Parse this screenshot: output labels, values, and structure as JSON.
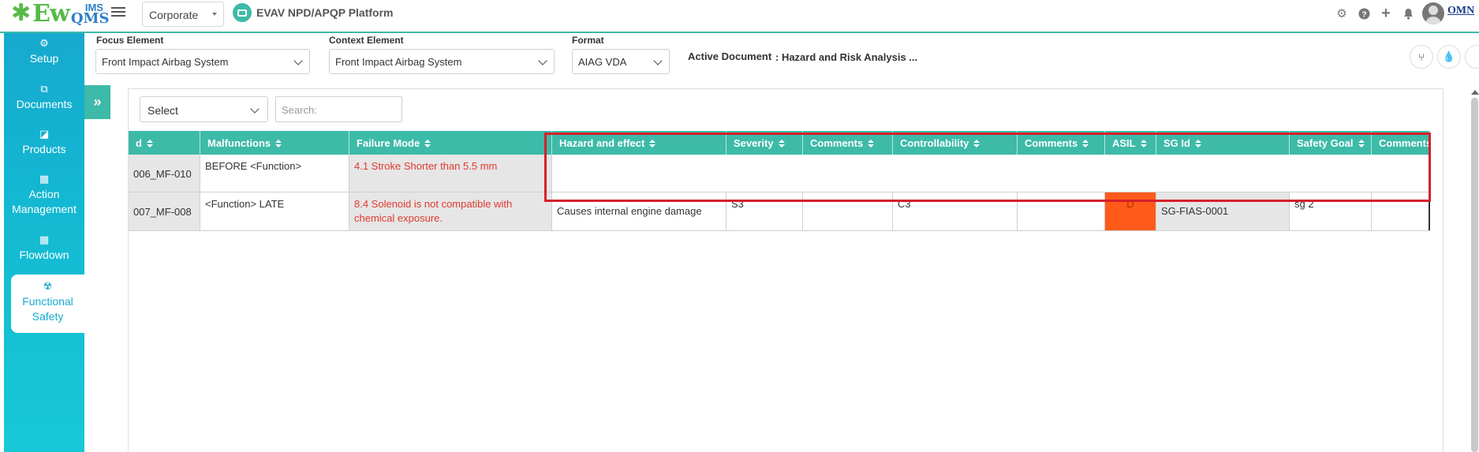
{
  "app": {
    "logo_main": "Ew",
    "logo_top": "IMS",
    "logo_bottom": "QMS",
    "org_select": "Corporate",
    "platform_name": "EVAV NPD/APQP Platform",
    "brand_partial": "OMN"
  },
  "top_icons": [
    "gear-icon",
    "help-icon",
    "plus-icon",
    "bell-icon",
    "user-avatar"
  ],
  "sidebar": {
    "items": [
      {
        "label": "Setup",
        "icon": "cogs-icon"
      },
      {
        "label": "Documents",
        "icon": "copy-icon"
      },
      {
        "label": "Products",
        "icon": "tag-icon"
      },
      {
        "label": "Action Management",
        "icon": "building-icon"
      },
      {
        "label": "Flowdown",
        "icon": "building-icon"
      },
      {
        "label": "Functional Safety",
        "icon": "safety-icon",
        "active": true
      }
    ]
  },
  "filters": {
    "focus_label": "Focus Element",
    "focus_value": "Front Impact Airbag System",
    "context_label": "Context Element",
    "context_value": "Front Impact Airbag System",
    "format_label": "Format",
    "format_value": "AIAG VDA",
    "active_doc_label": "Active Document",
    "active_doc_value": ": Hazard and Risk Analysis ..."
  },
  "toolbar": {
    "column_select": "Select",
    "search_placeholder": "Search:"
  },
  "table": {
    "headers": [
      "d",
      "Malfunctions",
      "Failure Mode",
      "Hazard and effect",
      "Severity",
      "Comments",
      "Controllability",
      "Comments",
      "ASIL",
      "SG Id",
      "Safety Goal",
      "Comments"
    ],
    "rows": [
      {
        "id": "006_MF-010",
        "malfunction": "BEFORE <Function>",
        "failure_mode": "4.1 Stroke Shorter than 5.5 mm",
        "hazard": "",
        "severity": "",
        "comments1": "",
        "controllability": "",
        "comments2": "",
        "asil": "",
        "sg_id": "",
        "safety_goal": "",
        "comments3": ""
      },
      {
        "id": "007_MF-008",
        "malfunction": "<Function> LATE",
        "failure_mode": "8.4 Solenoid is not compatible with chemical exposure.",
        "hazard": "Causes internal engine damage",
        "severity": "S3",
        "comments1": "",
        "controllability": "C3",
        "comments2": "",
        "asil": "D",
        "sg_id": "SG-FIAS-0001",
        "safety_goal": "sg 2",
        "comments3": ""
      }
    ]
  },
  "colors": {
    "teal": "#3dbaa8",
    "sidebar": "#16a9cf",
    "asil_d": "#ff5a1a",
    "highlight": "#d6202a",
    "failure_text": "#e03a2f"
  }
}
